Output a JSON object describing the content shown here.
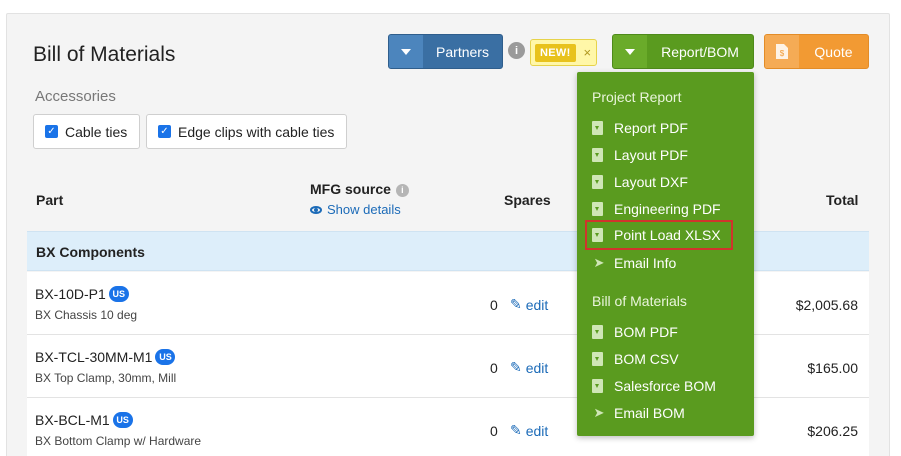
{
  "header": {
    "title": "Bill of Materials",
    "partners_label": "Partners",
    "info_glyph": "i",
    "new_badge": "NEW!",
    "new_badge_close": "×",
    "report_label": "Report/BOM",
    "quote_label": "Quote"
  },
  "accessories": {
    "label": "Accessories",
    "options": [
      {
        "label": "Cable ties",
        "checked": true
      },
      {
        "label": "Edge clips with cable ties",
        "checked": true
      }
    ]
  },
  "table": {
    "columns": {
      "part": "Part",
      "mfg": "MFG source",
      "show_details": "Show details",
      "spares": "Spares",
      "total": "Total"
    },
    "group": "BX Components",
    "rows": [
      {
        "part": "BX-10D-P1",
        "badge": "US",
        "desc": "BX Chassis 10 deg",
        "qty": "0",
        "edit": "edit",
        "total": "$2,005.68"
      },
      {
        "part": "BX-TCL-30MM-M1",
        "badge": "US",
        "desc": "BX Top Clamp, 30mm, Mill",
        "qty": "0",
        "edit": "edit",
        "total": "$165.00"
      },
      {
        "part": "BX-BCL-M1",
        "badge": "US",
        "desc": "BX Bottom Clamp w/ Hardware",
        "qty": "0",
        "edit": "edit",
        "total": "$206.25"
      }
    ]
  },
  "menu": {
    "project_header": "Project Report",
    "project_items": [
      {
        "label": "Report PDF",
        "icon": "file-download-icon"
      },
      {
        "label": "Layout PDF",
        "icon": "file-download-icon"
      },
      {
        "label": "Layout DXF",
        "icon": "file-download-icon"
      },
      {
        "label": "Engineering PDF",
        "icon": "file-download-icon"
      },
      {
        "label": "Point Load XLSX",
        "icon": "file-download-icon",
        "highlighted": true
      },
      {
        "label": "Email Info",
        "icon": "paper-plane-icon"
      }
    ],
    "bom_header": "Bill of Materials",
    "bom_items": [
      {
        "label": "BOM PDF",
        "icon": "file-download-icon"
      },
      {
        "label": "BOM CSV",
        "icon": "file-download-icon"
      },
      {
        "label": "Salesforce BOM",
        "icon": "file-download-icon"
      },
      {
        "label": "Email BOM",
        "icon": "paper-plane-icon"
      }
    ]
  },
  "colors": {
    "report_green": "#5a9b1f",
    "partners_blue": "#3a6fa3",
    "quote_orange": "#f29a33",
    "highlight_red": "#d0342c",
    "group_row_blue": "#ddeefa"
  }
}
